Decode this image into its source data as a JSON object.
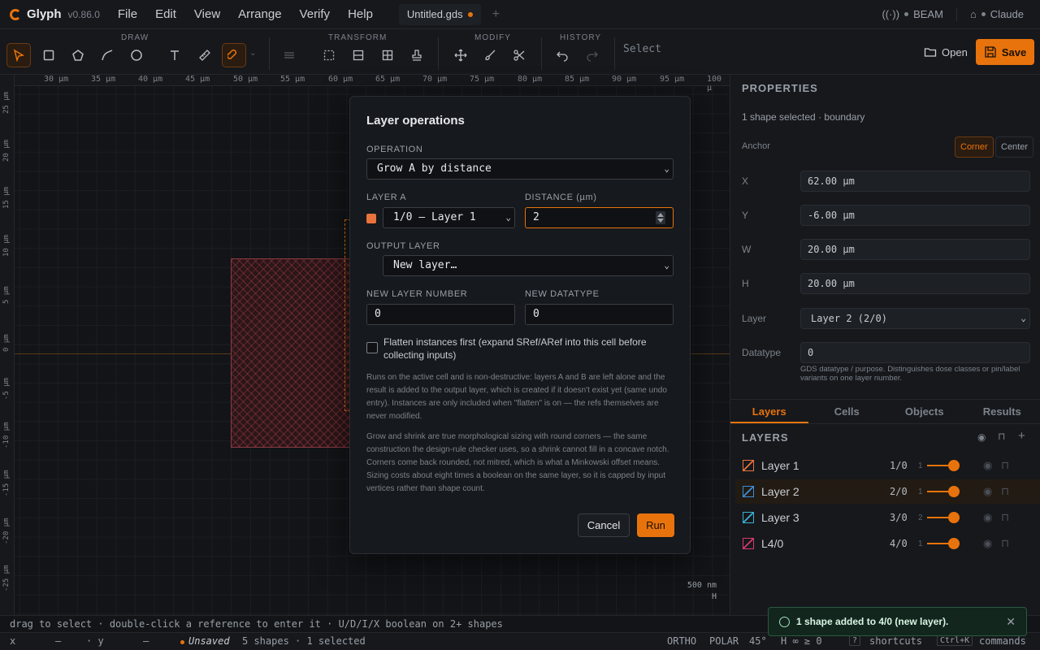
{
  "app": {
    "name": "Glyph",
    "version": "v0.86.0"
  },
  "menu": [
    "File",
    "Edit",
    "View",
    "Arrange",
    "Verify",
    "Help"
  ],
  "document_tab": {
    "name": "Untitled.gds"
  },
  "menu_right": {
    "backend": "BEAM",
    "assistant": "Claude"
  },
  "toolbar": {
    "groups": {
      "draw": "DRAW",
      "transform": "TRANSFORM",
      "modify": "MODIFY",
      "history": "HISTORY"
    },
    "mode_label": "Select",
    "open_label": "Open",
    "save_label": "Save"
  },
  "canvas": {
    "ruler_x": [
      "30 µm",
      "35 µm",
      "40 µm",
      "45 µm",
      "50 µm",
      "55 µm",
      "60 µm",
      "65 µm",
      "70 µm",
      "75 µm",
      "80 µm",
      "85 µm",
      "90 µm",
      "95 µm",
      "100 µ"
    ],
    "ruler_y": [
      "25 µm",
      "20 µm",
      "15 µm",
      "10 µm",
      "5 µm",
      "0 µm",
      "-5 µm",
      "-10 µm",
      "-15 µm",
      "-20 µm",
      "-25 µm"
    ],
    "scale": {
      "value": "500 nm",
      "axis": "H"
    }
  },
  "properties": {
    "title": "PROPERTIES",
    "summary": "1 shape selected · boundary",
    "anchor_label": "Anchor",
    "anchor_options": [
      "Corner",
      "Center"
    ],
    "x_label": "X",
    "x_value": "62.00 µm",
    "y_label": "Y",
    "y_value": "-6.00 µm",
    "w_label": "W",
    "w_value": "20.00 µm",
    "h_label": "H",
    "h_value": "20.00 µm",
    "layer_label": "Layer",
    "layer_value": "Layer 2 (2/0)",
    "datatype_label": "Datatype",
    "datatype_value": "0",
    "datatype_hint": "GDS datatype / purpose. Distinguishes dose classes or pin/label variants on one layer number."
  },
  "panel_tabs": [
    "Layers",
    "Cells",
    "Objects",
    "Results"
  ],
  "layers": {
    "title": "LAYERS",
    "items": [
      {
        "name": "Layer 1",
        "num": "1/0",
        "count": "1",
        "color": "#e8733c"
      },
      {
        "name": "Layer 2",
        "num": "2/0",
        "count": "1",
        "color": "#3a8fd6"
      },
      {
        "name": "Layer 3",
        "num": "3/0",
        "count": "2",
        "color": "#3ab0d6"
      },
      {
        "name": "L4/0",
        "num": "4/0",
        "count": "1",
        "color": "#d63a6a"
      }
    ]
  },
  "modal": {
    "title": "Layer operations",
    "operation_label": "OPERATION",
    "operation_value": "Grow A by distance",
    "layer_a_label": "LAYER A",
    "layer_a_value": "1/0 — Layer 1",
    "distance_label": "DISTANCE (µm)",
    "distance_value": "2",
    "output_label": "OUTPUT LAYER",
    "output_value": "New layer…",
    "new_number_label": "NEW LAYER NUMBER",
    "new_number_value": "0",
    "new_datatype_label": "NEW DATATYPE",
    "new_datatype_value": "0",
    "flatten_label": "Flatten instances first (expand SRef/ARef into this cell before collecting inputs)",
    "para1": "Runs on the active cell and is non-destructive: layers A and B are left alone and the result is added to the output layer, which is created if it doesn't exist yet (same undo entry). Instances are only included when \"flatten\" is on — the refs themselves are never modified.",
    "para2": "Grow and shrink are true morphological sizing with round corners — the same construction the design-rule checker uses, so a shrink cannot fill in a concave notch. Corners come back rounded, not mitred, which is what a Minkowski offset means. Sizing costs about eight times a boolean on the same layer, so it is capped by input vertices rather than shape count.",
    "cancel_label": "Cancel",
    "run_label": "Run"
  },
  "hint": "drag to select · double-click a reference to enter it · U/D/I/X boolean on 2+ shapes",
  "status": {
    "x_label": "x",
    "x_value": "—",
    "y_label": "· y",
    "y_value": "—",
    "saved_state": "Unsaved",
    "counts": "5 shapes · 1 selected",
    "ortho": "ORTHO",
    "polar": "POLAR",
    "angle": "45°",
    "grid": "H ∞ ≥ 0",
    "shortcuts_key": "?",
    "shortcuts_label": "shortcuts",
    "commands_key": "Ctrl+K",
    "commands_label": "commands"
  },
  "toast": {
    "message": "1 shape added to 4/0 (new layer)."
  }
}
